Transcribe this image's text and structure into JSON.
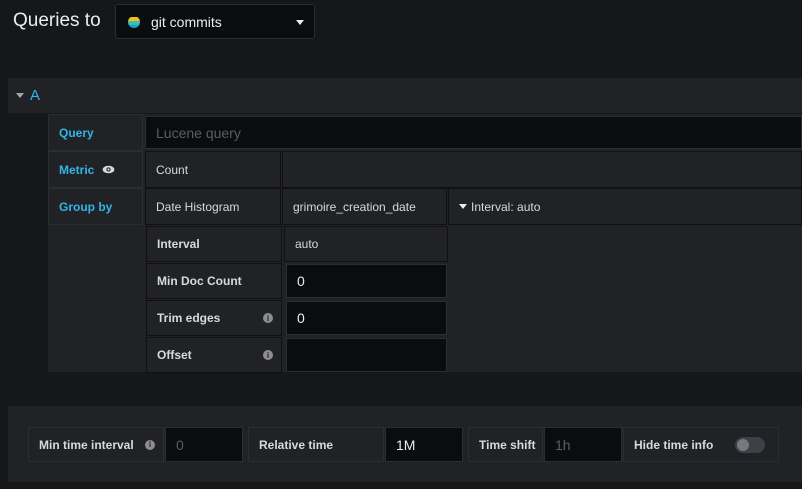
{
  "header": {
    "title": "Queries to",
    "datasource": "git commits"
  },
  "query": {
    "letter": "A",
    "query_label": "Query",
    "query_placeholder": "Lucene query",
    "metric_label": "Metric",
    "metric_type": "Count",
    "group_by_label": "Group by",
    "group_by_type": "Date Histogram",
    "group_by_field": "grimoire_creation_date",
    "interval_summary": "Interval: auto",
    "settings": {
      "interval_label": "Interval",
      "interval_value": "auto",
      "min_doc_label": "Min Doc Count",
      "min_doc_value": "0",
      "trim_label": "Trim edges",
      "trim_value": "0",
      "offset_label": "Offset",
      "offset_value": ""
    }
  },
  "options": {
    "min_interval_label": "Min time interval",
    "min_interval_placeholder": "0",
    "relative_time_label": "Relative time",
    "relative_time_value": "1M",
    "time_shift_label": "Time shift",
    "time_shift_placeholder": "1h",
    "hide_time_label": "Hide time info",
    "hide_time_enabled": false
  },
  "colors": {
    "accent": "#33b5e5",
    "background": "#161719",
    "panel": "#202226"
  }
}
